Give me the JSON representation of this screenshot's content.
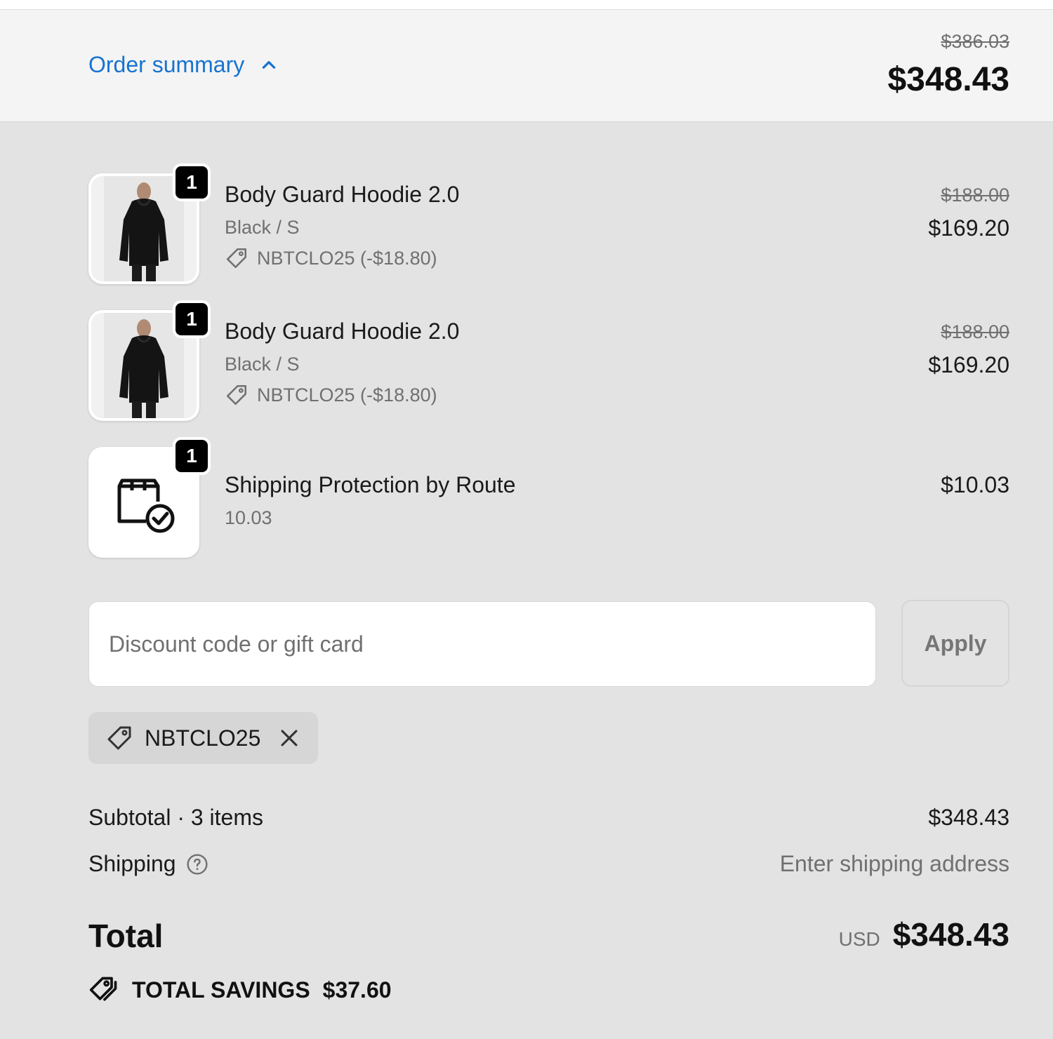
{
  "summary": {
    "toggle_label": "Order summary",
    "original_total": "$386.03",
    "total": "$348.43"
  },
  "items": [
    {
      "name": "Body Guard Hoodie 2.0",
      "variant": "Black / S",
      "discount": "NBTCLO25 (-$18.80)",
      "quantity": "1",
      "original_price": "$188.00",
      "price": "$169.20"
    },
    {
      "name": "Body Guard Hoodie 2.0",
      "variant": "Black / S",
      "discount": "NBTCLO25 (-$18.80)",
      "quantity": "1",
      "original_price": "$188.00",
      "price": "$169.20"
    },
    {
      "name": "Shipping Protection by Route",
      "variant": "10.03",
      "quantity": "1",
      "price": "$10.03"
    }
  ],
  "discount_form": {
    "placeholder": "Discount code or gift card",
    "value": "",
    "apply_label": "Apply"
  },
  "applied_code": "NBTCLO25",
  "totals": {
    "subtotal_label": "Subtotal · 3 items",
    "subtotal_value": "$348.43",
    "shipping_label": "Shipping",
    "shipping_value": "Enter shipping address",
    "total_label": "Total",
    "currency": "USD",
    "total_value": "$348.43",
    "savings_label": "TOTAL SAVINGS",
    "savings_value": "$37.60"
  },
  "colors": {
    "link": "#1773d0",
    "background": "#e4e3e4",
    "summary_bar": "#f4f4f4"
  }
}
